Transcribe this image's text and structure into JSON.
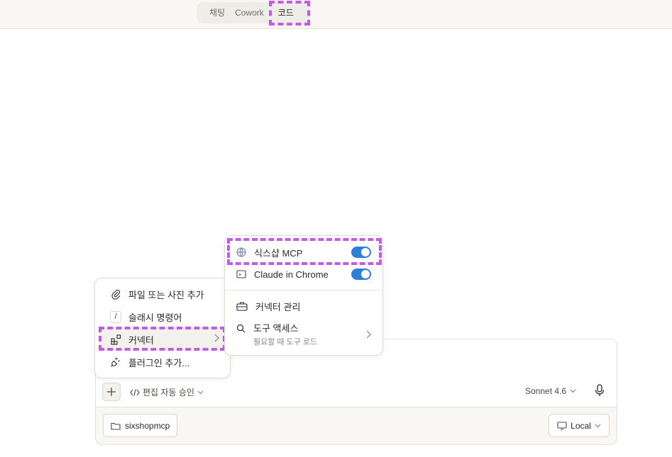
{
  "mode_tabs": {
    "chat": "채팅",
    "cowork": "Cowork",
    "code": "코드"
  },
  "composer": {
    "permission_label": "편집 자동 승인",
    "model_label": "Sonnet 4.6",
    "folder_label": "sixshopmcp",
    "environment_label": "Local"
  },
  "attach_menu": {
    "add_file": "파일 또는 사진 추가",
    "slash_symbol": "/",
    "slash_commands": "슬래시 명령어",
    "connectors": "커넥터",
    "add_plugin": "플러그인 추가..."
  },
  "connectors_menu": {
    "sixshop": {
      "label": "식스샵 MCP",
      "enabled": true
    },
    "chrome": {
      "label": "Claude in Chrome",
      "enabled": true
    },
    "manage": "커넥터 관리",
    "tool_access": "도구 액세스",
    "tool_access_sub": "필요할 때 도구 로드"
  },
  "icons": {
    "attach": "paperclip-icon",
    "slash": "slash-icon",
    "connectors": "blocks-icon",
    "plugin": "plug-icon",
    "globe": "globe-icon",
    "chrome": "browser-icon",
    "toolbox": "toolbox-icon",
    "search": "search-icon",
    "mic": "microphone-icon",
    "folder": "folder-icon",
    "monitor": "monitor-icon",
    "code": "code-icon"
  },
  "colors": {
    "accent": "#2f7fd6",
    "highlight": "#c25be6"
  }
}
